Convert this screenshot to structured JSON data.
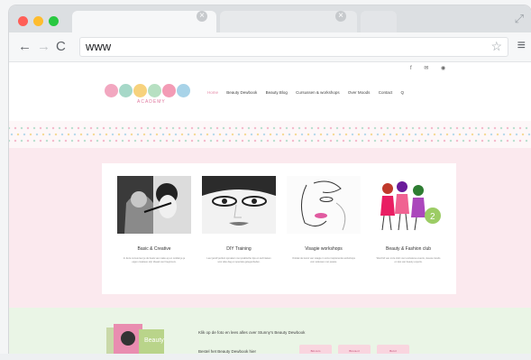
{
  "browser": {
    "address": "www",
    "icons": [
      "back-arrow-icon",
      "forward-arrow-icon",
      "reload-icon",
      "star-icon",
      "menu-icon",
      "expand-icon"
    ]
  },
  "site": {
    "social": "f  ✉  ◉",
    "logo_tagline": "ACADEMY",
    "nav": [
      "Home",
      "Beauty Dewbook",
      "Beauty Blog",
      "Cursussen & workshops",
      "Over Moods",
      "Contact",
      "Q"
    ],
    "cards": [
      {
        "title": "Basic & Creative",
        "desc": "In deze cursus leer je de basis van make-up en ontdek je je eigen creatieve stijl. Ideaal voor beginners."
      },
      {
        "title": "DIY Training",
        "desc": "Leer jezelf perfect opmaken met praktische tips en technieken voor elke dag en speciale gelegenheden."
      },
      {
        "title": "Visagie workshops",
        "desc": "Ontdek de kunst van visagie in onze inspirerende workshops voor iedereen met passie."
      },
      {
        "title": "Beauty & Fashion club",
        "desc": "Word lid van onze club voor exclusieve events, nieuwe trends en tips van beauty experts."
      }
    ],
    "cta_line1": "Klik op de foto en lees alles over Stunny's Beauty Dewbook",
    "cta_line2": "Bestel het Beauty Dewbook hier",
    "cta_buttons": [
      "Bol.com",
      "Bruna.nl",
      "Bol.nl"
    ]
  },
  "colors": {
    "close": "#ff5f57",
    "minimize": "#febc2e",
    "maximize": "#28c840",
    "pink_band": "#fbe9ee",
    "green_band": "#eaf5e6",
    "logo_dots": [
      "#f2a7c0",
      "#a6d8c8",
      "#f7d27d",
      "#b7e0c2",
      "#f39bb5",
      "#a8d3e8"
    ]
  }
}
